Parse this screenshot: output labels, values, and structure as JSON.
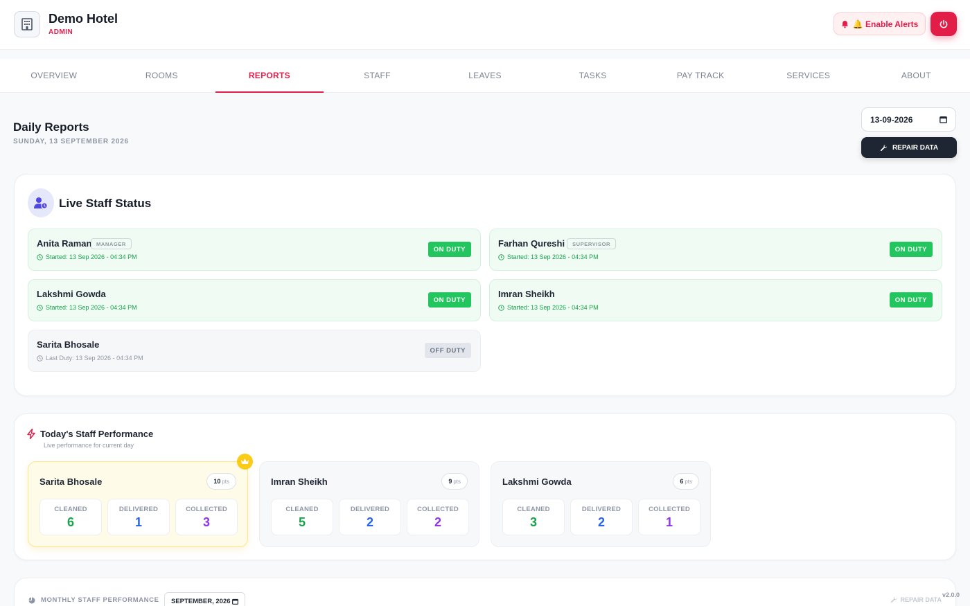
{
  "header": {
    "hotel_name": "Demo Hotel",
    "role": "ADMIN",
    "alerts_label": "🔔 Enable Alerts"
  },
  "tabs": [
    {
      "label": "OVERVIEW"
    },
    {
      "label": "ROOMS"
    },
    {
      "label": "REPORTS",
      "active": true
    },
    {
      "label": "STAFF"
    },
    {
      "label": "LEAVES"
    },
    {
      "label": "TASKS"
    },
    {
      "label": "PAY TRACK"
    },
    {
      "label": "SERVICES"
    },
    {
      "label": "ABOUT"
    }
  ],
  "page": {
    "title": "Daily Reports",
    "subtitle": "SUNDAY, 13 SEPTEMBER 2026",
    "date_value": "13-09-2026",
    "repair_label": "REPAIR DATA"
  },
  "live": {
    "title": "Live Staff Status",
    "staff": [
      {
        "name": "Anita Raman",
        "role": "MANAGER",
        "time": "Started: 13 Sep 2026 - 04:34 PM",
        "status": "ON DUTY"
      },
      {
        "name": "Farhan Qureshi",
        "role": "SUPERVISOR",
        "time": "Started: 13 Sep 2026 - 04:34 PM",
        "status": "ON DUTY"
      },
      {
        "name": "Lakshmi Gowda",
        "role": "",
        "time": "Started: 13 Sep 2026 - 04:34 PM",
        "status": "ON DUTY"
      },
      {
        "name": "Imran Sheikh",
        "role": "",
        "time": "Started: 13 Sep 2026 - 04:34 PM",
        "status": "ON DUTY"
      },
      {
        "name": "Sarita Bhosale",
        "role": "",
        "time": "Last Duty: 13 Sep 2026 - 04:34 PM",
        "status": "OFF DUTY"
      }
    ]
  },
  "performance": {
    "title": "Today's Staff Performance",
    "subtitle": "Live performance for current day",
    "pts_unit": "pts",
    "labels": {
      "cleaned": "CLEANED",
      "delivered": "DELIVERED",
      "collected": "COLLECTED"
    },
    "cards": [
      {
        "name": "Sarita Bhosale",
        "pts": "10",
        "cleaned": "6",
        "delivered": "1",
        "collected": "3"
      },
      {
        "name": "Imran Sheikh",
        "pts": "9",
        "cleaned": "5",
        "delivered": "2",
        "collected": "2"
      },
      {
        "name": "Lakshmi Gowda",
        "pts": "6",
        "cleaned": "3",
        "delivered": "2",
        "collected": "1"
      }
    ]
  },
  "monthly": {
    "title": "MONTHLY STAFF PERFORMANCE",
    "month_value": "SEPTEMBER, 2026",
    "repair_label": "REPAIR DATA"
  },
  "version": "v2.0.0",
  "colors": {
    "accent": "#e11d48",
    "on_duty": "#22c55e",
    "dark": "#1e2533"
  }
}
